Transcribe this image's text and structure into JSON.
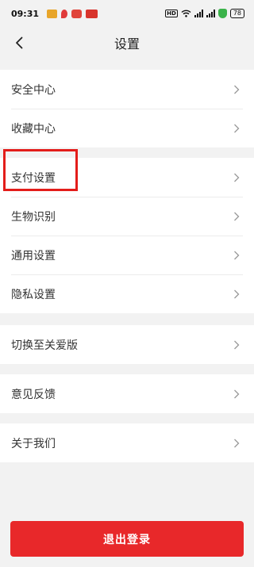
{
  "status_bar": {
    "time": "09:31",
    "hd": "HD",
    "battery": "78"
  },
  "nav": {
    "title": "设置"
  },
  "groups": [
    {
      "items": [
        {
          "label": "安全中心"
        },
        {
          "label": "收藏中心"
        }
      ]
    },
    {
      "items": [
        {
          "label": "支付设置"
        },
        {
          "label": "生物识别"
        },
        {
          "label": "通用设置"
        },
        {
          "label": "隐私设置"
        }
      ]
    },
    {
      "items": [
        {
          "label": "切换至关爱版"
        }
      ]
    },
    {
      "items": [
        {
          "label": "意见反馈"
        }
      ]
    },
    {
      "items": [
        {
          "label": "关于我们"
        }
      ]
    }
  ],
  "logout": {
    "label": "退出登录"
  },
  "colors": {
    "accent": "#e8282a",
    "highlight": "#e31d1a",
    "background": "#f2f2f2"
  }
}
